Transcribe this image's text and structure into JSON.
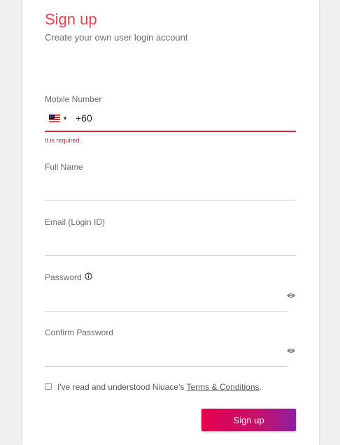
{
  "header": {
    "title": "Sign up",
    "subtitle": "Create your own user login account"
  },
  "mobile": {
    "label": "Mobile Number",
    "dial_code": "+60",
    "error": "It is required."
  },
  "full_name": {
    "label": "Full Name",
    "value": ""
  },
  "email": {
    "label": "Email (Login ID)",
    "value": ""
  },
  "password": {
    "label": "Password",
    "value": ""
  },
  "confirm_password": {
    "label": "Confirm Password",
    "value": ""
  },
  "terms": {
    "prefix": "I've read and understood Niuace's ",
    "link": "Terms & Conditions",
    "suffix": "."
  },
  "submit": {
    "label": "Sign up"
  },
  "icons": {
    "flag": "malaysia-flag-icon",
    "eye": "eye-icon",
    "info": "info-icon"
  },
  "colors": {
    "title": "#e8434f",
    "error": "#d6283a",
    "button_start": "#e5004f",
    "button_end": "#8e1fa0"
  }
}
